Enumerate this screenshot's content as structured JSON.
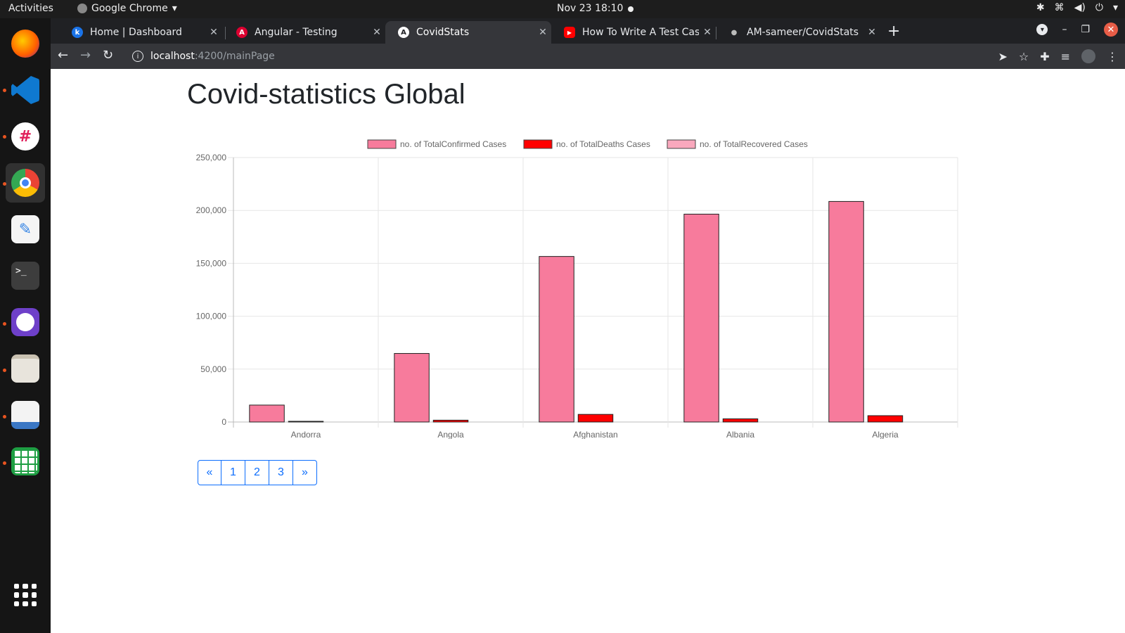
{
  "topbar": {
    "activities": "Activities",
    "app_name": "Google Chrome",
    "clock": "Nov 23  18:10"
  },
  "browser": {
    "tabs": [
      {
        "title": "Home | Dashboard",
        "favicon_color": "#1a73e8",
        "favicon_char": "k",
        "active": false
      },
      {
        "title": "Angular - Testing",
        "favicon_color": "#dd0031",
        "favicon_char": "A",
        "active": false
      },
      {
        "title": "CovidStats",
        "favicon_color": "#202124",
        "favicon_char": "A",
        "active": true
      },
      {
        "title": "How To Write A Test Case",
        "favicon_color": "#ff0000",
        "favicon_char": "▶",
        "active": false
      },
      {
        "title": "AM-sameer/CovidStats",
        "favicon_color": "#202124",
        "favicon_char": "●",
        "active": false
      }
    ],
    "url_host": "localhost",
    "url_path": ":4200/mainPage"
  },
  "page": {
    "title": "Covid-statistics Global",
    "pagination": [
      "«",
      "1",
      "2",
      "3",
      "»"
    ]
  },
  "chart_data": {
    "type": "bar",
    "categories": [
      "Andorra",
      "Angola",
      "Afghanistan",
      "Albania",
      "Algeria"
    ],
    "series": [
      {
        "name": "no. of TotalConfirmed Cases",
        "color": "#f77b9c",
        "values": [
          16000,
          64800,
          156500,
          196500,
          208500
        ]
      },
      {
        "name": "no. of TotalDeaths Cases",
        "color": "#ff0000",
        "values": [
          130,
          1730,
          7200,
          3000,
          6000
        ]
      },
      {
        "name": "no. of TotalRecovered Cases",
        "color": "#f9a8bd",
        "values": [
          0,
          0,
          0,
          0,
          0
        ]
      }
    ],
    "yticks": [
      "0",
      "50,000",
      "100,000",
      "150,000",
      "200,000",
      "250,000"
    ],
    "ylim": [
      0,
      250000
    ],
    "grid": true,
    "legend": "top"
  }
}
